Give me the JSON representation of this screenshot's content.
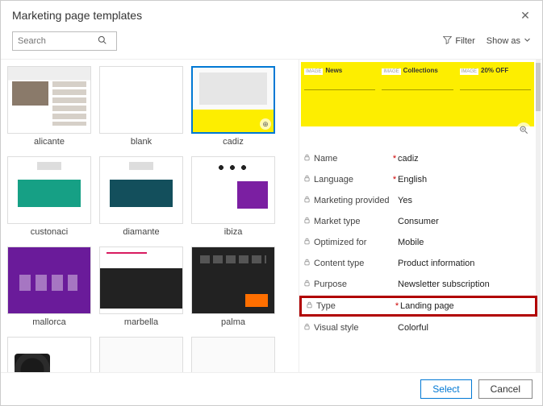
{
  "dialog": {
    "title": "Marketing page templates"
  },
  "search": {
    "placeholder": "Search"
  },
  "toolbar": {
    "filter": "Filter",
    "show_as": "Show as"
  },
  "gallery": {
    "items": [
      {
        "name": "alicante"
      },
      {
        "name": "blank"
      },
      {
        "name": "cadiz"
      },
      {
        "name": "custonaci"
      },
      {
        "name": "diamante"
      },
      {
        "name": "ibiza"
      },
      {
        "name": "mallorca"
      },
      {
        "name": "marbella"
      },
      {
        "name": "palma"
      }
    ],
    "selected": "cadiz"
  },
  "preview": {
    "cols": [
      {
        "chip": "IMAGE",
        "headline": "News"
      },
      {
        "chip": "IMAGE",
        "headline": "Collections"
      },
      {
        "chip": "IMAGE",
        "headline": "20% OFF"
      }
    ]
  },
  "fields": [
    {
      "label": "Name",
      "required": true,
      "value": "cadiz"
    },
    {
      "label": "Language",
      "required": true,
      "value": "English"
    },
    {
      "label": "Marketing provided",
      "required": false,
      "value": "Yes"
    },
    {
      "label": "Market type",
      "required": false,
      "value": "Consumer"
    },
    {
      "label": "Optimized for",
      "required": false,
      "value": "Mobile"
    },
    {
      "label": "Content type",
      "required": false,
      "value": "Product information"
    },
    {
      "label": "Purpose",
      "required": false,
      "value": "Newsletter subscription"
    },
    {
      "label": "Type",
      "required": true,
      "value": "Landing page",
      "highlight": true
    },
    {
      "label": "Visual style",
      "required": false,
      "value": "Colorful"
    }
  ],
  "footer": {
    "select": "Select",
    "cancel": "Cancel"
  }
}
